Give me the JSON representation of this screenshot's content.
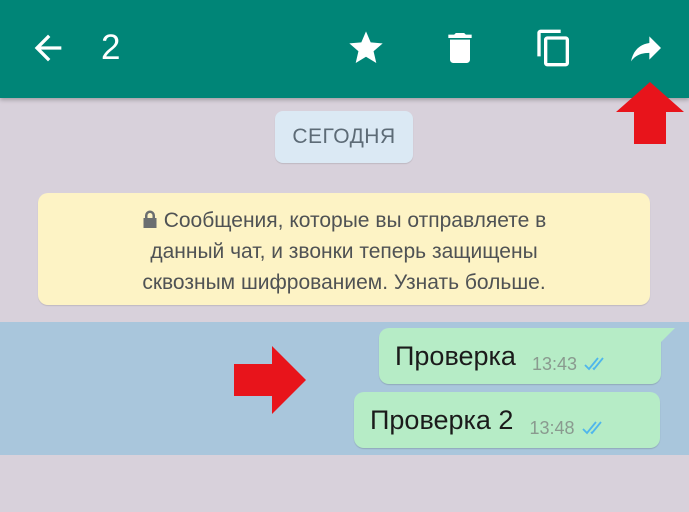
{
  "colors": {
    "toolbar": "#008577",
    "chat_background": "#d8d1db",
    "selection_band": "#a9c6dc",
    "outgoing_bubble": "#b6ecc6",
    "notice_background": "#fdf3c5",
    "date_chip_background": "#dbe9f4",
    "read_ticks": "#4fb6ec",
    "annotation_arrow": "#e8141b"
  },
  "toolbar": {
    "selected_count": "2",
    "icons": [
      "back-arrow-icon",
      "star-icon",
      "trash-icon",
      "copy-icon",
      "forward-icon"
    ]
  },
  "chat": {
    "date_chip": "СЕГОДНЯ",
    "encryption_notice": {
      "lines": [
        "Сообщения, которые вы отправляете в",
        "данный чат, и звонки теперь защищены",
        "сквозным шифрованием. Узнать больше."
      ]
    },
    "messages": [
      {
        "text": "Проверка",
        "time": "13:43",
        "status": "read"
      },
      {
        "text": "Проверка 2",
        "time": "13:48",
        "status": "read"
      }
    ]
  },
  "annotations": [
    "red-arrow-up",
    "red-arrow-right"
  ]
}
